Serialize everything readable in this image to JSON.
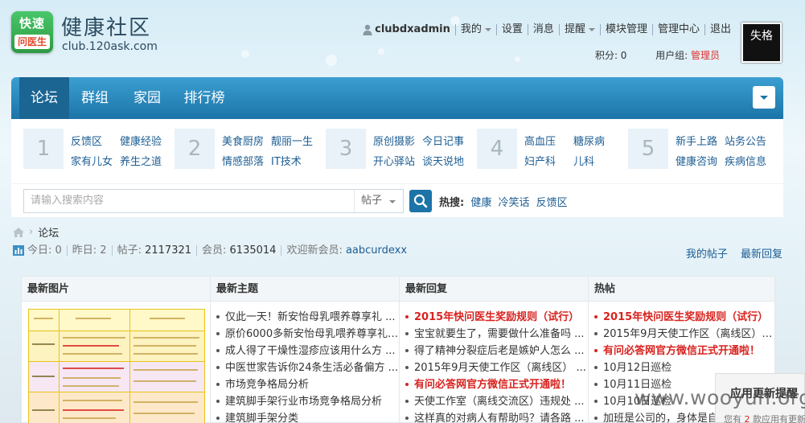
{
  "header": {
    "logo_top": "快速",
    "logo_bottom": "问医生",
    "site_name": "健康社区",
    "site_domain": "club.120ask.com",
    "avatar_text": "失格"
  },
  "usernav": {
    "username": "clubdxadmin",
    "items": [
      "我的",
      "设置",
      "消息",
      "提醒",
      "模块管理",
      "管理中心",
      "退出"
    ]
  },
  "userinfo": {
    "points_label": "积分: 0",
    "group_label": "用户组:",
    "group_value": "管理员"
  },
  "nav": {
    "tabs": [
      "论坛",
      "群组",
      "家园",
      "排行榜"
    ],
    "active": "论坛"
  },
  "categories": [
    {
      "num": "1",
      "links": [
        "反馈区",
        "健康经验",
        "家有儿女",
        "养生之道"
      ]
    },
    {
      "num": "2",
      "links": [
        "美食厨房",
        "靓丽一生",
        "情感部落",
        "IT技术"
      ]
    },
    {
      "num": "3",
      "links": [
        "原创摄影",
        "今日记事",
        "开心驿站",
        "谈天说地"
      ]
    },
    {
      "num": "4",
      "links": [
        "高血压",
        "糖尿病",
        "妇产科",
        "儿科"
      ]
    },
    {
      "num": "5",
      "links": [
        "新手上路",
        "站务公告",
        "健康咨询",
        "疾病信息"
      ]
    }
  ],
  "search": {
    "placeholder": "请输入搜索内容",
    "scope": "帖子",
    "hot_label": "热搜:",
    "hot_terms": [
      "健康",
      "冷笑话",
      "反馈区"
    ]
  },
  "breadcrumb": {
    "current": "论坛"
  },
  "stats": {
    "today": "今日: 0",
    "yesterday": "昨日: 2",
    "posts_label": "帖子: ",
    "posts": "2117321",
    "members_label": "会员: ",
    "members": "6135014",
    "welcome": "欢迎新会员: ",
    "new_member": "aabcurdexx",
    "my_posts": "我的帖子",
    "latest_replies_link": "最新回复"
  },
  "columns": {
    "images": {
      "title": "最新图片"
    },
    "topics": {
      "title": "最新主题",
      "items": [
        {
          "text": "仅此一天！新安怡母乳喂养尊享礼 ...",
          "hot": false
        },
        {
          "text": "原价6000多新安怡母乳喂养尊享礼 ...",
          "hot": false
        },
        {
          "text": "成人得了干燥性湿疹应该用什么方 ...",
          "hot": false
        },
        {
          "text": "中医世家告诉你24条生活必备偏方 ...",
          "hot": false
        },
        {
          "text": "市场竞争格局分析",
          "hot": false
        },
        {
          "text": "建筑脚手架行业市场竞争格局分析",
          "hot": false
        },
        {
          "text": "建筑脚手架分类",
          "hot": false
        }
      ]
    },
    "replies": {
      "title": "最新回复",
      "items": [
        {
          "text": "2015年快问医生奖励规则（试行）",
          "hot": true
        },
        {
          "text": "宝宝就要生了，需要做什么准备吗 ...",
          "hot": false
        },
        {
          "text": "得了精神分裂症后老是嫉妒人怎么 ...",
          "hot": false
        },
        {
          "text": "2015年9月天使工作区（离线区） ...",
          "hot": false
        },
        {
          "text": "有问必答网官方微信正式开通啦！",
          "hot": true
        },
        {
          "text": "天使工作室（离线交流区）违规处 ...",
          "hot": false
        },
        {
          "text": "这样真的对病人有帮助吗？请各路 ...",
          "hot": false
        }
      ]
    },
    "hot": {
      "title": "热帖",
      "items": [
        {
          "text": "2015年快问医生奖励规则（试行）",
          "hot": true
        },
        {
          "text": "2015年9月天使工作区（离线区） ...",
          "hot": false
        },
        {
          "text": "有问必答网官方微信正式开通啦！",
          "hot": true
        },
        {
          "text": "10月12日巡检",
          "hot": false
        },
        {
          "text": "10月11日巡检",
          "hot": false
        },
        {
          "text": "10月10日巡检",
          "hot": false
        },
        {
          "text": "加班是公司的，身体是自己 ...",
          "hot": false
        }
      ]
    }
  },
  "popup": {
    "title": "应用更新提醒",
    "sub_prefix": "您有 ",
    "sub_count": "2",
    "sub_suffix": " 款应用有更新"
  },
  "watermark": "www.wooyun.org",
  "colors": {
    "nav_blue": "#1c74a8",
    "link_blue": "#1c5d93",
    "hot_red": "#d8231f",
    "logo_green": "#2e9a44"
  }
}
